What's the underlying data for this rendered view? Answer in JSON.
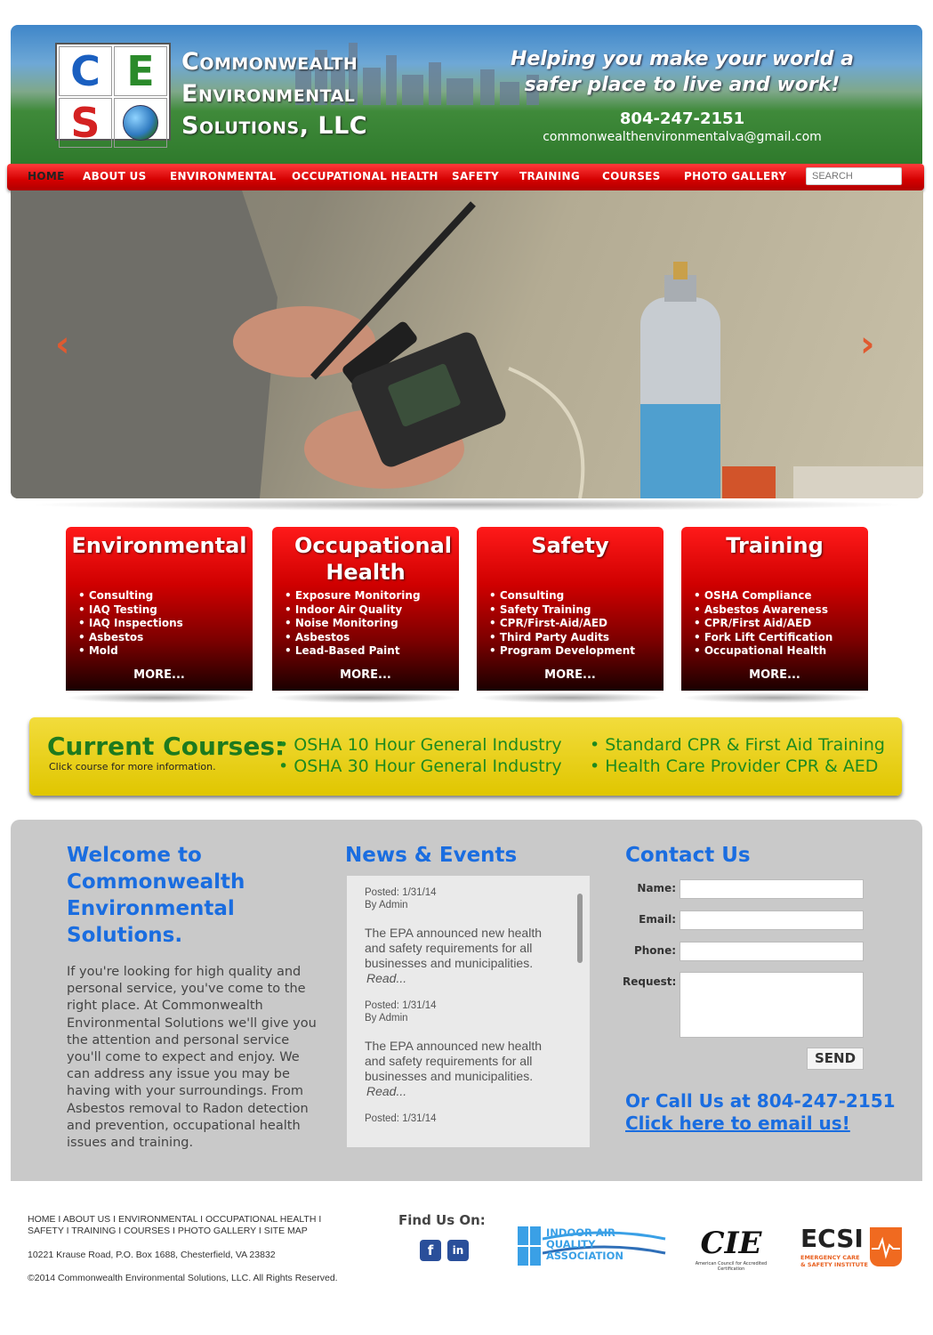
{
  "header": {
    "logo_letters": [
      "C",
      "E",
      "S"
    ],
    "company_lines": [
      "Commonwealth",
      "Environmental",
      "Solutions, LLC"
    ],
    "tagline_lines": [
      "Helping you make your world a",
      "safer place to live and work!"
    ],
    "phone": "804-247-2151",
    "email": "commonwealthenvironmentalva@gmail.com"
  },
  "nav": {
    "items": [
      "HOME",
      "ABOUT US",
      "ENVIRONMENTAL",
      "OCCUPATIONAL HEALTH",
      "SAFETY",
      "TRAINING",
      "COURSES",
      "PHOTO GALLERY"
    ],
    "active": "HOME",
    "search_placeholder": "SEARCH"
  },
  "hero": {
    "prev": "‹",
    "next": "›"
  },
  "services": [
    {
      "title": "Environmental",
      "items": [
        "Consulting",
        "IAQ Testing",
        "IAQ Inspections",
        "Asbestos",
        "Mold"
      ],
      "more": "MORE..."
    },
    {
      "title": "Occupational Health",
      "items": [
        "Exposure Monitoring",
        "Indoor Air Quality",
        "Noise Monitoring",
        "Asbestos",
        "Lead-Based Paint"
      ],
      "more": "MORE..."
    },
    {
      "title": "Safety",
      "items": [
        "Consulting",
        "Safety Training",
        "CPR/First-Aid/AED",
        "Third Party Audits",
        "Program Development"
      ],
      "more": "MORE..."
    },
    {
      "title": "Training",
      "items": [
        "OSHA Compliance",
        "Asbestos Awareness",
        "CPR/First Aid/AED",
        "Fork Lift Certification",
        "Occupational Health"
      ],
      "more": "MORE..."
    }
  ],
  "courses": {
    "title": "Current Courses:",
    "subtitle": "Click course for more information.",
    "list": [
      "• OSHA 10 Hour General Industry",
      "• OSHA 30 Hour General Industry",
      "• Standard CPR & First Aid Training",
      "• Health Care Provider CPR & AED"
    ]
  },
  "welcome": {
    "title_lines": [
      "Welcome to",
      "Commonwealth",
      "Environmental",
      "Solutions."
    ],
    "body": "If you're looking for high quality and personal service, you've come to the right place. At Commonwealth Environmental Solutions we'll give you the attention and personal service you'll come to expect and enjoy. We can address any issue you may be having with your surroundings. From Asbestos removal to Radon detection and prevention, occupational health issues and training."
  },
  "news": {
    "title": "News & Events",
    "items": [
      {
        "posted": "Posted: 1/31/14",
        "by": "By Admin",
        "body": "The EPA announced new health and safety requirements for all businesses and municipalities.",
        "read": "Read..."
      },
      {
        "posted": "Posted: 1/31/14",
        "by": "By Admin",
        "body": "The EPA announced new health and safety requirements for all businesses and municipalities.",
        "read": "Read..."
      },
      {
        "posted": "Posted: 1/31/14"
      }
    ]
  },
  "contact": {
    "title": "Contact Us",
    "labels": {
      "name": "Name:",
      "email": "Email:",
      "phone": "Phone:",
      "request": "Request:"
    },
    "send": "SEND",
    "call": "Or Call Us at 804-247-2151",
    "email_link": "Click here to email us!"
  },
  "footer": {
    "links_line1": [
      "HOME",
      "ABOUT US",
      "ENVIRONMENTAL",
      "OCCUPATIONAL HEALTH"
    ],
    "links_line2": [
      "SAFETY",
      "TRAINING",
      "COURSES",
      "PHOTO GALLERY",
      "SITE MAP"
    ],
    "address": "10221 Krause Road, P.O. Box 1688, Chesterfield, VA 23832",
    "copyright": "©2014 Commonwealth Environmental Solutions, LLC. All Rights Reserved.",
    "find_us": "Find Us On:",
    "social": {
      "facebook": "f",
      "linkedin": "in"
    },
    "partners": {
      "iaqa": "INDOOR AIR QUALITY ASSOCIATION",
      "cie": "CIE",
      "cie_sub": "American Council for Accredited Certification",
      "ecsi": "ECSI",
      "ecsi_sub1": "EMERGENCY CARE",
      "ecsi_sub2": "& SAFETY INSTITUTE"
    }
  },
  "colors": {
    "nav_red": "#d40000",
    "link_blue": "#1a6de0",
    "course_yellow": "#e8cf10",
    "course_green": "#1e8a1e",
    "panel_gray": "#c9c9c9"
  }
}
